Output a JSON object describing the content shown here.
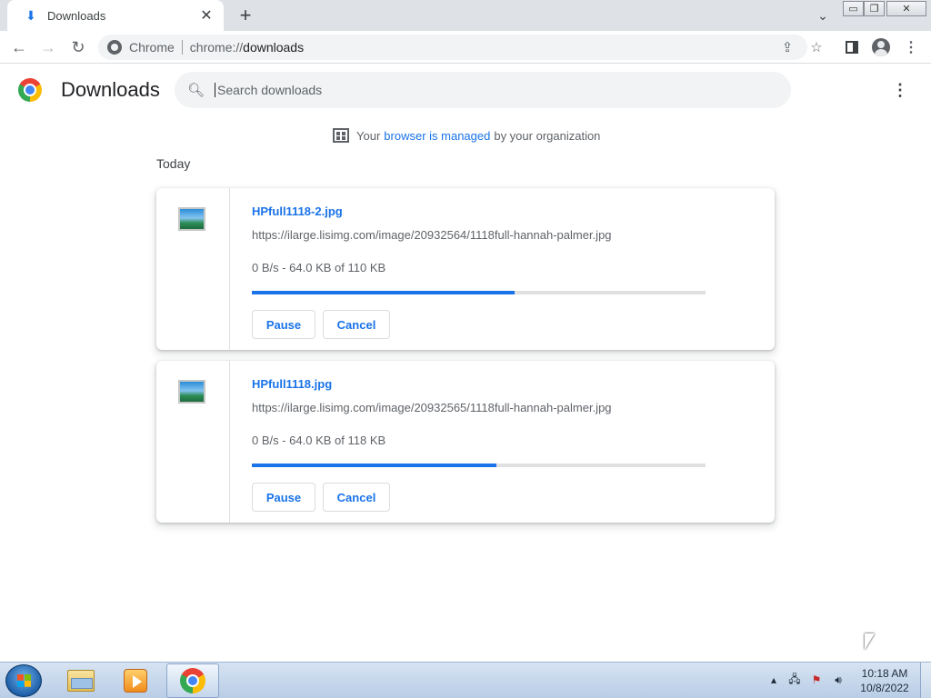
{
  "browser": {
    "tab": {
      "title": "Downloads",
      "icon": "download-icon"
    },
    "new_tab_symbol": "+",
    "window_controls": {
      "minimize": "▭",
      "restore": "❐",
      "close": "✕"
    },
    "omnibox": {
      "chip": "Chrome",
      "url_scheme": "chrome://",
      "url_host": "downloads"
    }
  },
  "downloads_page": {
    "title": "Downloads",
    "search": {
      "placeholder": "Search downloads"
    },
    "managed_notice": {
      "prefix": "Your",
      "link": "browser is managed",
      "suffix": "by your organization"
    },
    "section_label": "Today",
    "items": [
      {
        "filename": "HPfull1118-2.jpg",
        "url": "https://ilarge.lisimg.com/image/20932564/1118full-hannah-palmer.jpg",
        "status": "0 B/s - 64.0 KB of 110 KB",
        "progress": 0.58,
        "pause_label": "Pause",
        "cancel_label": "Cancel"
      },
      {
        "filename": "HPfull1118.jpg",
        "url": "https://ilarge.lisimg.com/image/20932565/1118full-hannah-palmer.jpg",
        "status": "0 B/s - 64.0 KB of 118 KB",
        "progress": 0.54,
        "pause_label": "Pause",
        "cancel_label": "Cancel"
      }
    ]
  },
  "taskbar": {
    "clock_time": "10:18 AM",
    "clock_date": "10/8/2022"
  },
  "colors": {
    "accent": "#1a73e8",
    "tabstrip": "#dee1e6",
    "omnibox": "#f1f3f4"
  }
}
